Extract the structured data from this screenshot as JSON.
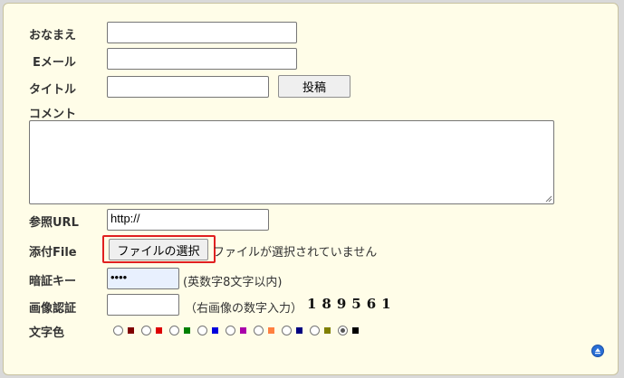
{
  "form": {
    "name_label": "おなまえ",
    "email_label": "Eメール",
    "title_label": "タイトル",
    "post_button": "投稿",
    "comment_label": "コメント",
    "url_label": "参照URL",
    "url_value": "http://",
    "file_label": "添付File",
    "file_button": "ファイルの選択",
    "file_status": "ファイルが選択されていません",
    "password_label": "暗証キー",
    "password_value": "••••",
    "password_hint": "(英数字8文字以内)",
    "captcha_label": "画像認証",
    "captcha_hint": "（右画像の数字入力）",
    "captcha_digits": "189561",
    "color_label": "文字色",
    "colors": [
      "#800000",
      "#dd0000",
      "#008000",
      "#0000dd",
      "#aa00aa",
      "#ff8040",
      "#000080",
      "#808000",
      "#000000"
    ],
    "selected_color_index": 8
  },
  "icons": {
    "page_top": "arrow-up-circle-icon"
  },
  "highlight_color": "#e02020"
}
